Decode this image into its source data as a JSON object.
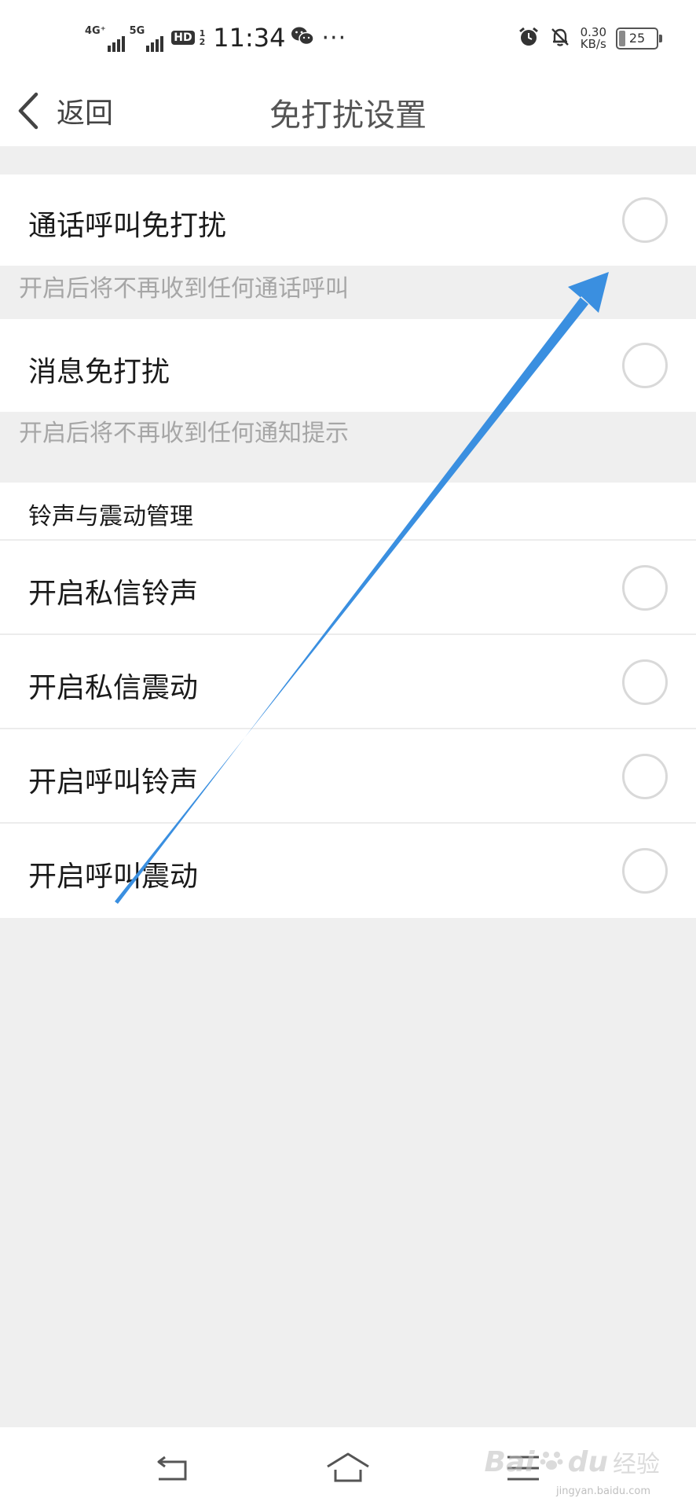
{
  "status_bar": {
    "network_1": "4G⁺",
    "network_2": "5G",
    "hd_label": "HD",
    "hd_sub_top": "1",
    "hd_sub_bottom": "2",
    "time": "11:34",
    "more": "···",
    "speed_value": "0.30",
    "speed_unit": "KB/s",
    "battery_level": "25",
    "icons": [
      "wechat-icon",
      "alarm-icon",
      "bell-off-icon",
      "battery-icon"
    ]
  },
  "navbar": {
    "back_label": "返回",
    "title": "免打扰设置"
  },
  "settings": {
    "call_dnd": {
      "label": "通话呼叫免打扰",
      "hint": "开启后将不再收到任何通话呼叫",
      "enabled": false
    },
    "message_dnd": {
      "label": "消息免打扰",
      "hint": "开启后将不再收到任何通知提示",
      "enabled": false
    },
    "ring_section": {
      "title": "铃声与震动管理",
      "items": [
        {
          "label": "开启私信铃声",
          "enabled": false
        },
        {
          "label": "开启私信震动",
          "enabled": false
        },
        {
          "label": "开启呼叫铃声",
          "enabled": false
        },
        {
          "label": "开启呼叫震动",
          "enabled": false
        }
      ]
    }
  },
  "watermark": {
    "brand": "Bai",
    "brand_suffix": "du",
    "cn": "经验",
    "url": "jingyan.baidu.com"
  },
  "colors": {
    "annotation_arrow": "#3a8fe0",
    "background": "#efefef",
    "toggle_border": "#d9d9d9"
  }
}
